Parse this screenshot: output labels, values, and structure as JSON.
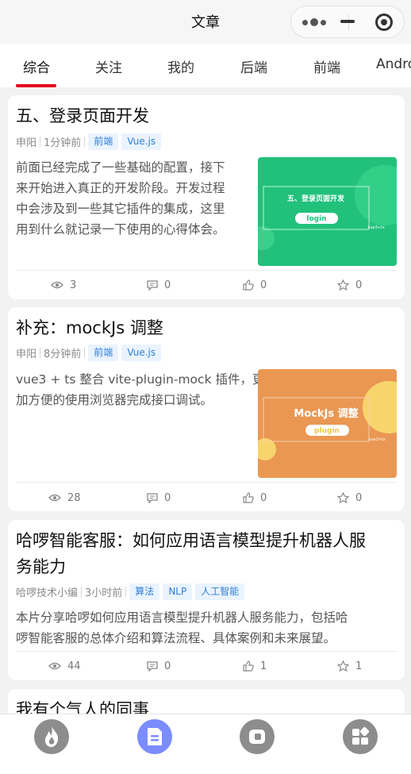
{
  "nav": {
    "title": "文章"
  },
  "tabs": [
    "综合",
    "关注",
    "我的",
    "后端",
    "前端",
    "Andro"
  ],
  "articles": [
    {
      "title": "五、登录页面开发",
      "author": "申阳",
      "time": "1分钟前",
      "tags": [
        "前端",
        "Vue.js"
      ],
      "summary_lines": [
        "前面已经完成了一些基础的配置，接下",
        "来开始进入真正的开发阶段。开发过程",
        "中会涉及到一些其它插件的集成，这里",
        "用到什么就记录一下使用的心得体会。"
      ],
      "thumb": {
        "title": "五、登录页面开发",
        "button": "login",
        "caption": "vue3+ts",
        "bg": "#21c17b"
      },
      "stats": {
        "views": "3",
        "comments": "0",
        "likes": "0",
        "stars": "0"
      }
    },
    {
      "title": "补充：mockJs 调整",
      "author": "申阳",
      "time": "8分钟前",
      "tags": [
        "前端",
        "Vue.js"
      ],
      "summary_lines": [
        "vue3 + ts 整合 vite-plugin-mock 插件，更",
        "加方便的使用浏览器完成接口调试。"
      ],
      "thumb": {
        "title": "MockJs 调整",
        "button": "plugin",
        "caption": "vue3+ts",
        "bg": "#ea9753"
      },
      "stats": {
        "views": "28",
        "comments": "0",
        "likes": "0",
        "stars": "0"
      }
    },
    {
      "title_lines": [
        "哈啰智能客服：如何应用语言模型提升机器人服",
        "务能力"
      ],
      "author": "哈啰技术小编",
      "time": "3小时前",
      "tags": [
        "算法",
        "NLP",
        "人工智能"
      ],
      "summary_lines": [
        "本片分享哈啰如何应用语言模型提升机器人服务能力，包括哈",
        "啰智能客服的总体介绍和算法流程、具体案例和未来展望。"
      ],
      "stats": {
        "views": "44",
        "comments": "0",
        "likes": "1",
        "stars": "1"
      }
    },
    {
      "title": "我有个气人的同事"
    }
  ],
  "tabbar": [
    "fire-icon",
    "article-icon",
    "chat-icon",
    "apps-icon"
  ],
  "colors": {
    "accent": "#e5001e",
    "tag_bg": "#eaf4ff",
    "tag_text": "#2f7ed8",
    "active_tab_icon": "#7b8cff"
  }
}
